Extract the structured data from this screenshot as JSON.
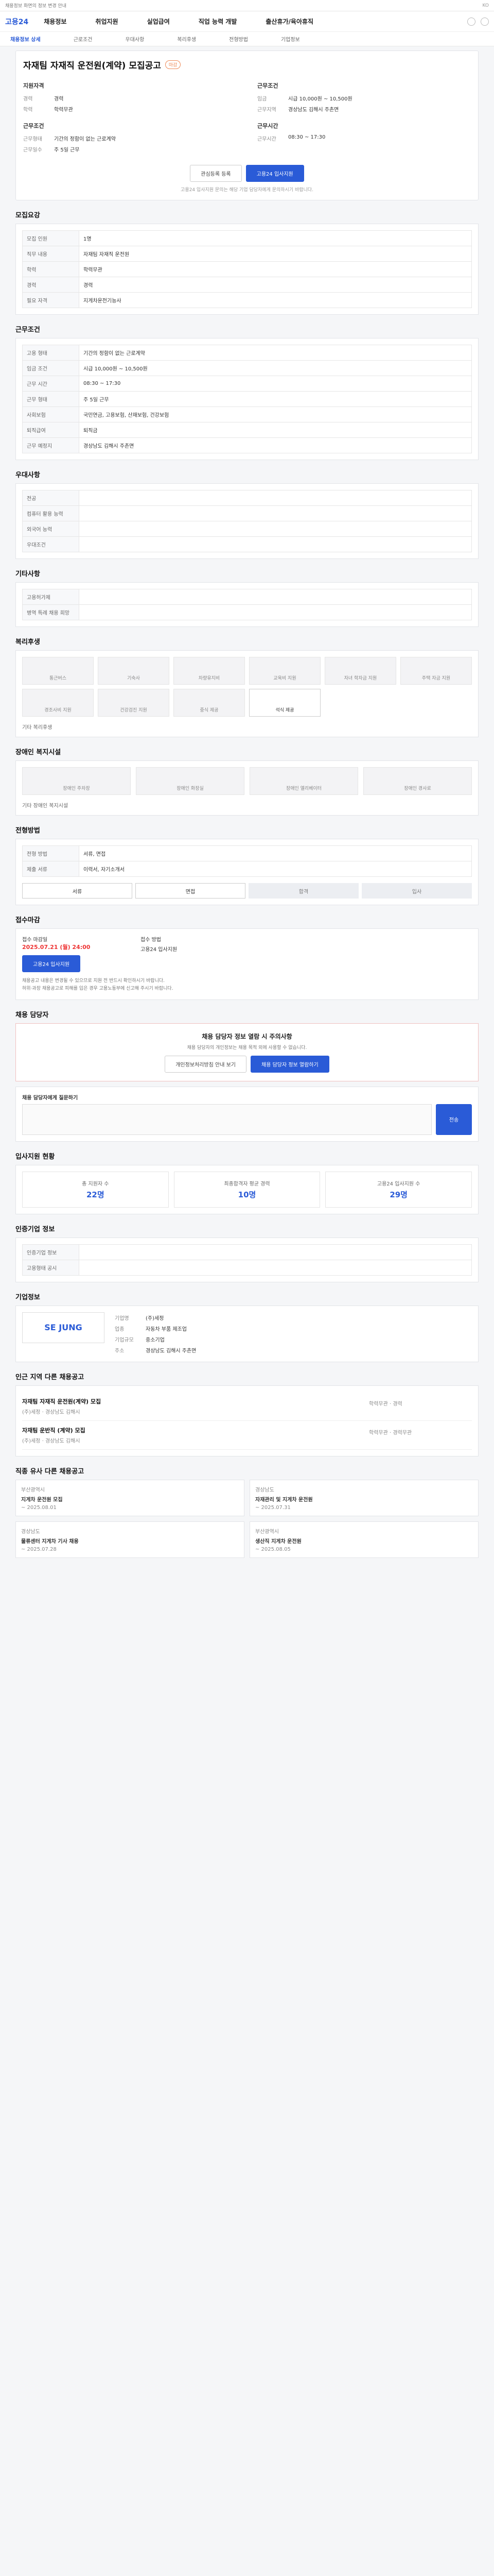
{
  "topbar": {
    "notice": "채용정보 화면의 정보 변경 안내",
    "lang": "KO"
  },
  "header": {
    "logo": "고용24",
    "nav": [
      "채용정보",
      "취업지원",
      "실업급여",
      "직업 능력 개발",
      "출산휴가/육아휴직"
    ]
  },
  "subnav": [
    "채용정보 상세",
    "근로조건",
    "우대사항",
    "복리후생",
    "전형방법",
    "기업정보"
  ],
  "job": {
    "title": "자재팀 자재직 운전원(계약) 모집공고",
    "tag": "마감",
    "left_h": "지원자격",
    "left": [
      {
        "k": "경력",
        "v": "경력"
      },
      {
        "k": "학력",
        "v": "학력무관"
      }
    ],
    "left2_h": "근무조건",
    "left2": [
      {
        "k": "근무형태",
        "v": "기간의 정함이 없는 근로계약"
      },
      {
        "k": "근무일수",
        "v": "주 5일 근무"
      }
    ],
    "right_h": "근무조건",
    "right": [
      {
        "k": "임금",
        "v": "시급 10,000원 ~ 10,500원"
      },
      {
        "k": "근무지역",
        "v": "경상남도 김해시 주촌면"
      }
    ],
    "right2_h": "근무시간",
    "right2": [
      {
        "k": "근무시간",
        "v": "08:30 ~ 17:30"
      }
    ],
    "btn_save": "관심등록 등록",
    "btn_apply": "고용24 입사지원",
    "notice": "고용24 입사지원 문의는 해당 기업 담당자에게 문의하시기 바랍니다."
  },
  "sections": {
    "recruit": "모집요강",
    "cond": "근무조건",
    "pref": "우대사항",
    "etc": "기타사항",
    "welfare": "복리후생",
    "disabled": "장애인 복지시설",
    "process": "전형방법",
    "deadline": "접수마감",
    "manager": "채용 담당자",
    "stats": "입사지원 현황",
    "info": "인증기업 정보",
    "company": "기업정보",
    "rec": "인근 지역 다른 채용공고",
    "similar": "직종 유사 다른 채용공고"
  },
  "recruit_table": [
    {
      "k": "모집 인원",
      "v": "1명"
    },
    {
      "k": "직무 내용",
      "v": "자재팀 자재직 운전원"
    },
    {
      "k": "학력",
      "v": "학력무관"
    },
    {
      "k": "경력",
      "v": "경력"
    },
    {
      "k": "필요 자격",
      "v": "지게차운전기능사"
    }
  ],
  "cond_table": [
    {
      "k": "고용 형태",
      "v": "기간의 정함이 없는 근로계약"
    },
    {
      "k": "임금 조건",
      "v": "시급 10,000원 ~ 10,500원"
    },
    {
      "k": "근무 시간",
      "v": "08:30 ~ 17:30"
    },
    {
      "k": "근무 형태",
      "v": "주 5일 근무"
    },
    {
      "k": "사회보험",
      "v": "국민연금, 고용보험, 산재보험, 건강보험"
    },
    {
      "k": "퇴직급여",
      "v": "퇴직금"
    },
    {
      "k": "근무 예정지",
      "v": "경상남도 김해시 주촌면"
    }
  ],
  "pref_table": [
    {
      "k": "전공",
      "v": ""
    },
    {
      "k": "컴퓨터 활용 능력",
      "v": ""
    },
    {
      "k": "외국어 능력",
      "v": ""
    },
    {
      "k": "우대조건",
      "v": ""
    }
  ],
  "etc_table": [
    {
      "k": "고용허가제",
      "v": ""
    },
    {
      "k": "병역 특례 채용 희망",
      "v": ""
    }
  ],
  "welfare_items": [
    "통근버스",
    "기숙사",
    "차량유지비",
    "교육비 지원",
    "자녀 학자금 지원",
    "주택 자금 지원",
    "경조사비 지원",
    "건강검진 지원",
    "중식 제공",
    "석식 제공"
  ],
  "welfare_note": "기타 복리후생",
  "disabled_items": [
    "장애인 주차장",
    "장애인 화장실",
    "장애인 엘리베이터",
    "장애인 경사로"
  ],
  "disabled_note": "기타 장애인 복지시설",
  "process_table": [
    {
      "k": "전형 방법",
      "v": "서류, 면접"
    },
    {
      "k": "제출 서류",
      "v": "이력서, 자기소개서"
    }
  ],
  "process_steps": [
    "서류",
    "면접",
    "합격",
    "입사"
  ],
  "deadline": {
    "label": "접수 마감일",
    "date": "2025.07.21 (월) 24:00",
    "method_label": "접수 방법",
    "method": "고용24 입사지원",
    "apply": "고용24 입사지원"
  },
  "warnings": [
    "채용공고 내용은 변경될 수 있으므로 지원 전 반드시 확인하시기 바랍니다.",
    "허위·과장 채용공고로 피해를 입은 경우 고용노동부에 신고해 주시기 바랍니다."
  ],
  "manager": {
    "alert_title": "채용 담당자 정보 열람 시 주의사항",
    "alert_body": "채용 담당자의 개인정보는 채용 목적 외에 사용할 수 없습니다.",
    "btn1": "개인정보처리방침 안내 보기",
    "btn2": "채용 담당자 정보 열람하기",
    "q_label": "채용 담당자에게 질문하기",
    "send": "전송"
  },
  "stats": [
    {
      "label": "총 지원자 수",
      "value": "22명"
    },
    {
      "label": "최종합격자 평균 경력",
      "value": "10명"
    },
    {
      "label": "고용24 입사지원 수",
      "value": "29명"
    }
  ],
  "info_table": [
    {
      "k": "인증기업 정보",
      "v": ""
    },
    {
      "k": "고용형태 공시",
      "v": ""
    }
  ],
  "company": {
    "logo": "SE JUNG",
    "name_k": "기업명",
    "name": "(주)세정",
    "industry_k": "업종",
    "industry": "자동차 부품 제조업",
    "size_k": "기업규모",
    "size": "중소기업",
    "addr_k": "주소",
    "addr": "경상남도 김해시 주촌면"
  },
  "recs": [
    {
      "title": "자재팀 자재직 운전원(계약) 모집",
      "sub": "(주)세정 · 경상남도 김해시",
      "info": "학력무관 · 경력"
    },
    {
      "title": "자재팀 운반직 (계약) 모집",
      "sub": "(주)세정 · 경상남도 김해시",
      "info": "학력무관 · 경력무관"
    }
  ],
  "similar": [
    {
      "tag": "부산광역시",
      "title": "지게차 운전원 모집",
      "date": "~ 2025.08.01"
    },
    {
      "tag": "경상남도",
      "title": "자재관리 및 지게차 운전원",
      "date": "~ 2025.07.31"
    },
    {
      "tag": "경상남도",
      "title": "물류센터 지게차 기사 채용",
      "date": "~ 2025.07.28"
    },
    {
      "tag": "부산광역시",
      "title": "생산직 지게차 운전원",
      "date": "~ 2025.08.05"
    }
  ]
}
